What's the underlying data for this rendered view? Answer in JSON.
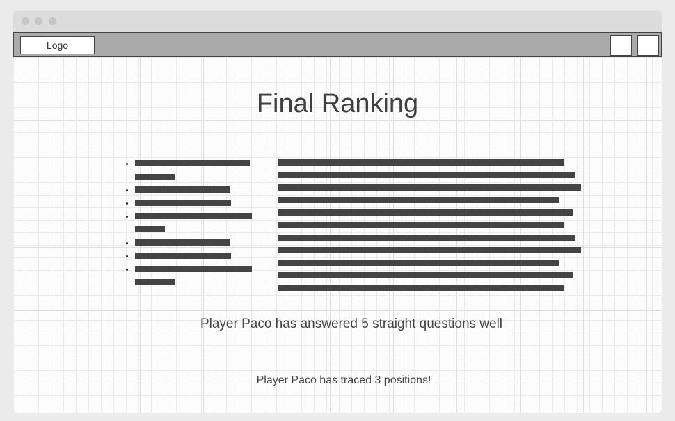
{
  "toolbar": {
    "logo_label": "Logo"
  },
  "main": {
    "title": "Final Ranking",
    "message_streak": "Player Paco has answered 5 straight questions well",
    "message_positions": "Player Paco has traced 3 positions!"
  },
  "colors": {
    "placeholder_bar": "#444444",
    "toolbar": "#aaaaaa",
    "titlebar": "#dcdcdc"
  }
}
